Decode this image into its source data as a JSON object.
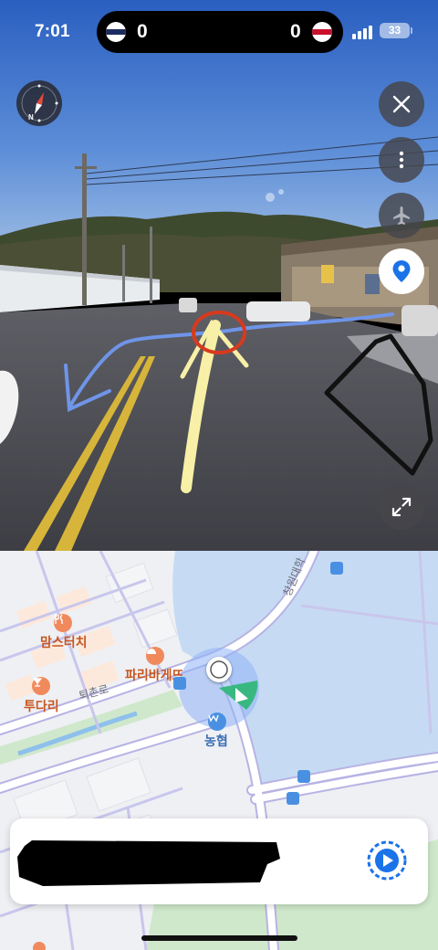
{
  "status_bar": {
    "time": "7:01",
    "score_left": "0",
    "score_right": "0",
    "battery_percent": "33",
    "signal_bars": 4
  },
  "street_view": {
    "compass_label": "N",
    "buttons": {
      "close": "close-icon",
      "more": "more-vertical-icon",
      "flight_mode": "airplane-icon",
      "location": "location-pin-icon",
      "expand": "expand-icon"
    },
    "accent_color": "#1a73e8"
  },
  "map": {
    "places": {
      "moms_touch": "맘스터치",
      "paris_baguette": "파리바게뜨",
      "tudari": "투다리",
      "nonghyup": "농협"
    },
    "roads": {
      "toechon_ro": "퇴촌로",
      "changwon_daehak": "창원대학"
    },
    "colors": {
      "water": "#c6dbf3",
      "park": "#cfe8cb",
      "road_main": "#ffffff",
      "road_outline": "#b7b3e4",
      "poi_orange": "#f08a5d",
      "view_cone": "#2bb673"
    }
  },
  "card": {
    "play_icon": "street-view-play-icon"
  }
}
